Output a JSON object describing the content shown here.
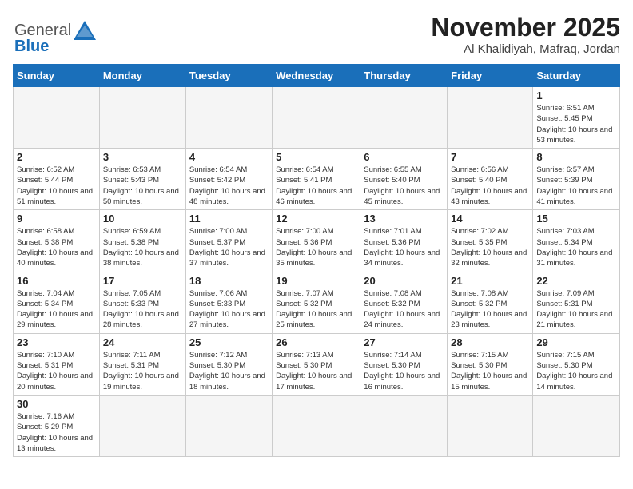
{
  "header": {
    "logo_general": "General",
    "logo_blue": "Blue",
    "title": "November 2025",
    "subtitle": "Al Khalidiyah, Mafraq, Jordan"
  },
  "weekdays": [
    "Sunday",
    "Monday",
    "Tuesday",
    "Wednesday",
    "Thursday",
    "Friday",
    "Saturday"
  ],
  "weeks": [
    [
      {
        "day": "",
        "info": ""
      },
      {
        "day": "",
        "info": ""
      },
      {
        "day": "",
        "info": ""
      },
      {
        "day": "",
        "info": ""
      },
      {
        "day": "",
        "info": ""
      },
      {
        "day": "",
        "info": ""
      },
      {
        "day": "1",
        "info": "Sunrise: 6:51 AM\nSunset: 5:45 PM\nDaylight: 10 hours\nand 53 minutes."
      }
    ],
    [
      {
        "day": "2",
        "info": "Sunrise: 6:52 AM\nSunset: 5:44 PM\nDaylight: 10 hours\nand 51 minutes."
      },
      {
        "day": "3",
        "info": "Sunrise: 6:53 AM\nSunset: 5:43 PM\nDaylight: 10 hours\nand 50 minutes."
      },
      {
        "day": "4",
        "info": "Sunrise: 6:54 AM\nSunset: 5:42 PM\nDaylight: 10 hours\nand 48 minutes."
      },
      {
        "day": "5",
        "info": "Sunrise: 6:54 AM\nSunset: 5:41 PM\nDaylight: 10 hours\nand 46 minutes."
      },
      {
        "day": "6",
        "info": "Sunrise: 6:55 AM\nSunset: 5:40 PM\nDaylight: 10 hours\nand 45 minutes."
      },
      {
        "day": "7",
        "info": "Sunrise: 6:56 AM\nSunset: 5:40 PM\nDaylight: 10 hours\nand 43 minutes."
      },
      {
        "day": "8",
        "info": "Sunrise: 6:57 AM\nSunset: 5:39 PM\nDaylight: 10 hours\nand 41 minutes."
      }
    ],
    [
      {
        "day": "9",
        "info": "Sunrise: 6:58 AM\nSunset: 5:38 PM\nDaylight: 10 hours\nand 40 minutes."
      },
      {
        "day": "10",
        "info": "Sunrise: 6:59 AM\nSunset: 5:38 PM\nDaylight: 10 hours\nand 38 minutes."
      },
      {
        "day": "11",
        "info": "Sunrise: 7:00 AM\nSunset: 5:37 PM\nDaylight: 10 hours\nand 37 minutes."
      },
      {
        "day": "12",
        "info": "Sunrise: 7:00 AM\nSunset: 5:36 PM\nDaylight: 10 hours\nand 35 minutes."
      },
      {
        "day": "13",
        "info": "Sunrise: 7:01 AM\nSunset: 5:36 PM\nDaylight: 10 hours\nand 34 minutes."
      },
      {
        "day": "14",
        "info": "Sunrise: 7:02 AM\nSunset: 5:35 PM\nDaylight: 10 hours\nand 32 minutes."
      },
      {
        "day": "15",
        "info": "Sunrise: 7:03 AM\nSunset: 5:34 PM\nDaylight: 10 hours\nand 31 minutes."
      }
    ],
    [
      {
        "day": "16",
        "info": "Sunrise: 7:04 AM\nSunset: 5:34 PM\nDaylight: 10 hours\nand 29 minutes."
      },
      {
        "day": "17",
        "info": "Sunrise: 7:05 AM\nSunset: 5:33 PM\nDaylight: 10 hours\nand 28 minutes."
      },
      {
        "day": "18",
        "info": "Sunrise: 7:06 AM\nSunset: 5:33 PM\nDaylight: 10 hours\nand 27 minutes."
      },
      {
        "day": "19",
        "info": "Sunrise: 7:07 AM\nSunset: 5:32 PM\nDaylight: 10 hours\nand 25 minutes."
      },
      {
        "day": "20",
        "info": "Sunrise: 7:08 AM\nSunset: 5:32 PM\nDaylight: 10 hours\nand 24 minutes."
      },
      {
        "day": "21",
        "info": "Sunrise: 7:08 AM\nSunset: 5:32 PM\nDaylight: 10 hours\nand 23 minutes."
      },
      {
        "day": "22",
        "info": "Sunrise: 7:09 AM\nSunset: 5:31 PM\nDaylight: 10 hours\nand 21 minutes."
      }
    ],
    [
      {
        "day": "23",
        "info": "Sunrise: 7:10 AM\nSunset: 5:31 PM\nDaylight: 10 hours\nand 20 minutes."
      },
      {
        "day": "24",
        "info": "Sunrise: 7:11 AM\nSunset: 5:31 PM\nDaylight: 10 hours\nand 19 minutes."
      },
      {
        "day": "25",
        "info": "Sunrise: 7:12 AM\nSunset: 5:30 PM\nDaylight: 10 hours\nand 18 minutes."
      },
      {
        "day": "26",
        "info": "Sunrise: 7:13 AM\nSunset: 5:30 PM\nDaylight: 10 hours\nand 17 minutes."
      },
      {
        "day": "27",
        "info": "Sunrise: 7:14 AM\nSunset: 5:30 PM\nDaylight: 10 hours\nand 16 minutes."
      },
      {
        "day": "28",
        "info": "Sunrise: 7:15 AM\nSunset: 5:30 PM\nDaylight: 10 hours\nand 15 minutes."
      },
      {
        "day": "29",
        "info": "Sunrise: 7:15 AM\nSunset: 5:30 PM\nDaylight: 10 hours\nand 14 minutes."
      }
    ],
    [
      {
        "day": "30",
        "info": "Sunrise: 7:16 AM\nSunset: 5:29 PM\nDaylight: 10 hours\nand 13 minutes."
      },
      {
        "day": "",
        "info": ""
      },
      {
        "day": "",
        "info": ""
      },
      {
        "day": "",
        "info": ""
      },
      {
        "day": "",
        "info": ""
      },
      {
        "day": "",
        "info": ""
      },
      {
        "day": "",
        "info": ""
      }
    ]
  ]
}
